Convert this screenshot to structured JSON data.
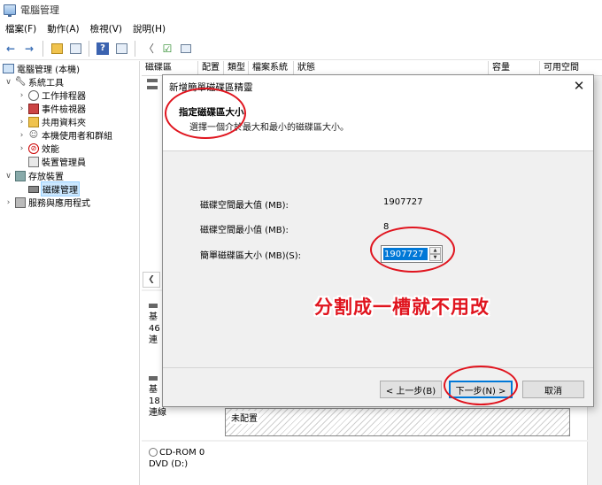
{
  "window": {
    "title": "電腦管理"
  },
  "menu": [
    "檔案(F)",
    "動作(A)",
    "檢視(V)",
    "說明(H)"
  ],
  "toolbar_icons": [
    "back-icon",
    "forward-icon",
    "up-folder-icon",
    "show-hide-tree-icon",
    "help-icon",
    "properties-icon",
    "connect-icon",
    "check-icon",
    "export-icon"
  ],
  "tree": {
    "root": "電腦管理 (本機)",
    "system_tools": "系統工具",
    "task_scheduler": "工作排程器",
    "event_viewer": "事件檢視器",
    "shared_folders": "共用資料夾",
    "local_users": "本機使用者和群組",
    "performance": "效能",
    "device_manager": "裝置管理員",
    "storage": "存放裝置",
    "disk_management": "磁碟管理",
    "services": "服務與應用程式"
  },
  "columns": [
    "磁碟區",
    "配置",
    "類型",
    "檔案系統",
    "狀態",
    "容量",
    "可用空間"
  ],
  "disks": {
    "disk0_lines": [
      "基",
      "46",
      "連"
    ],
    "disk1_lines": [
      "基",
      "18",
      "連線"
    ],
    "unallocated": "未配置",
    "cdrom_name": "CD-ROM 0",
    "cdrom_type": "DVD (D:)"
  },
  "dialog": {
    "title": "新增簡單磁碟區精靈",
    "heading": "指定磁碟區大小",
    "subheading": "選擇一個介於最大和最小的磁碟區大小。",
    "max_label": "磁碟空間最大值 (MB):",
    "max_value": "1907727",
    "min_label": "磁碟空間最小值 (MB):",
    "min_value": "8",
    "size_label": "簡單磁碟區大小 (MB)(S):",
    "size_value": "1907727",
    "back": "< 上一步(B)",
    "next": "下一步(N) >",
    "cancel": "取消"
  },
  "annotation": {
    "callout": "分割成一槽就不用改",
    "color": "#e0141e"
  }
}
